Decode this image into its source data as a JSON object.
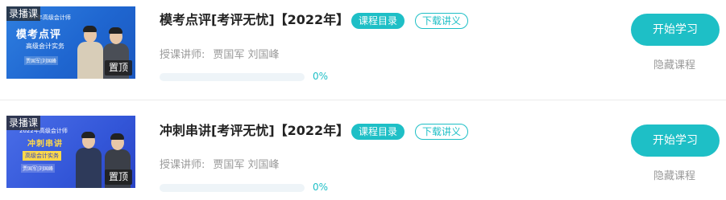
{
  "courses": [
    {
      "title": "模考点评[考评无忧]【2022年】",
      "record_tag": "录播课",
      "top_tag": "置顶",
      "thumb_sub": "2022年高级会计师",
      "thumb_big": "模考点评",
      "thumb_mid": "高级会计实务",
      "thumb_names": "贾国军|刘国峰",
      "catalog_label": "课程目录",
      "handout_label": "下载讲义",
      "lecturer_label": "授课讲师:",
      "lecturers": "贾国军 刘国峰",
      "progress": 0,
      "progress_text": "0%",
      "start_label": "开始学习",
      "hide_label": "隐藏课程"
    },
    {
      "title": "冲刺串讲[考评无忧]【2022年】",
      "record_tag": "录播课",
      "top_tag": "置顶",
      "thumb_sub": "2022年高级会计师",
      "thumb_big": "冲刺串讲",
      "thumb_mid": "高级会计实务",
      "thumb_names": "贾国军|刘国峰",
      "catalog_label": "课程目录",
      "handout_label": "下载讲义",
      "lecturer_label": "授课讲师:",
      "lecturers": "贾国军 刘国峰",
      "progress": 0,
      "progress_text": "0%",
      "start_label": "开始学习",
      "hide_label": "隐藏课程"
    }
  ],
  "colors": {
    "accent": "#1ebfc6",
    "muted_text": "#999999",
    "title_text": "#222222"
  }
}
